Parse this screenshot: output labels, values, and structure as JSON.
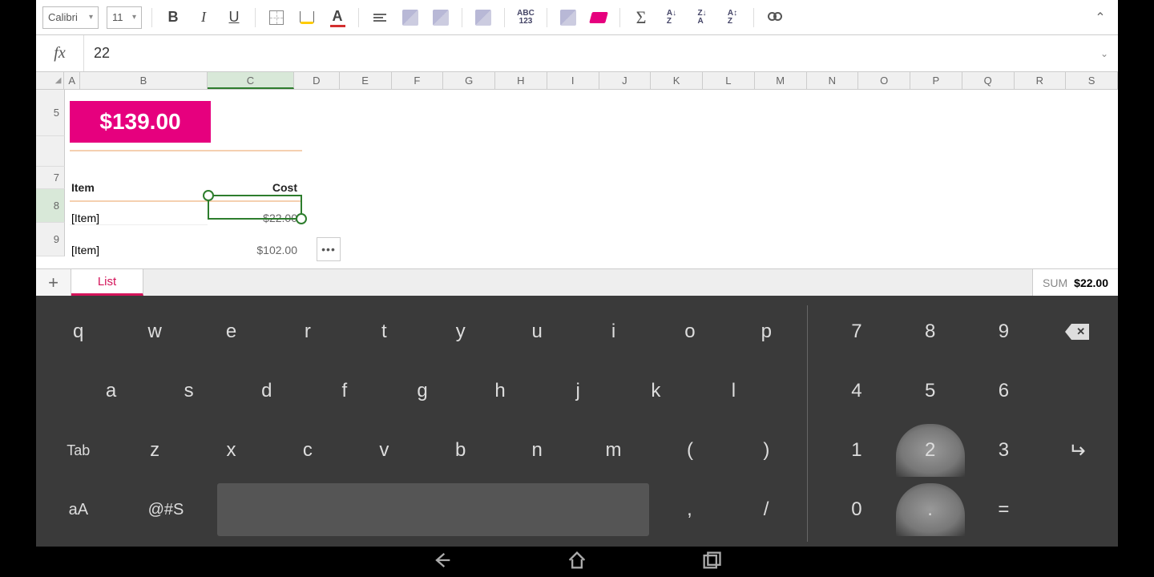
{
  "toolbar": {
    "font_name": "Calibri",
    "font_size": "11",
    "bold": "B",
    "italic": "I",
    "underline": "U",
    "fontcolor_letter": "A",
    "abc_label": "ABC\n123",
    "sigma": "Σ",
    "sort_az": "A↓\nZ",
    "sort_za": "Z↓\nA",
    "sort_azn": "A↕\nZ"
  },
  "formula": {
    "fx": "fx",
    "value": "22"
  },
  "columns": [
    "A",
    "B",
    "C",
    "D",
    "E",
    "F",
    "G",
    "H",
    "I",
    "J",
    "K",
    "L",
    "M",
    "N",
    "O",
    "P",
    "Q",
    "R",
    "S"
  ],
  "rows": {
    "r5": "5",
    "r7": "7",
    "r8": "8",
    "r9": "9"
  },
  "cells": {
    "total": "$139.00",
    "header_item": "Item",
    "header_cost": "Cost",
    "item1": "[Item]",
    "cost1": "$22.00",
    "item2": "[Item]",
    "cost2": "$102.00",
    "context": "•••"
  },
  "sheets": {
    "add": "+",
    "tab1": "List"
  },
  "status": {
    "label": "SUM",
    "value": "$22.00"
  },
  "keyboard": {
    "row1": [
      "q",
      "w",
      "e",
      "r",
      "t",
      "y",
      "u",
      "i",
      "o",
      "p"
    ],
    "row2": [
      "a",
      "s",
      "d",
      "f",
      "g",
      "h",
      "j",
      "k",
      "l"
    ],
    "row3": [
      "Tab",
      "z",
      "x",
      "c",
      "v",
      "b",
      "n",
      "m",
      "(",
      ")"
    ],
    "row4": [
      "aA",
      "@#S",
      "",
      ",",
      "/"
    ],
    "num1": [
      "7",
      "8",
      "9"
    ],
    "num2": [
      "4",
      "5",
      "6"
    ],
    "num3": [
      "1",
      "2",
      "3"
    ],
    "num4": [
      "0",
      ".",
      "="
    ]
  }
}
